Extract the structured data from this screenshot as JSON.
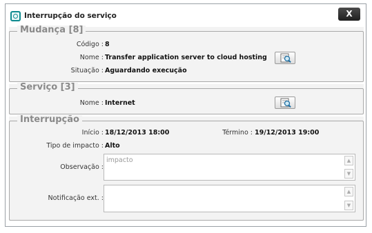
{
  "dialog": {
    "title": "Interrupção do serviço",
    "close_label": "X"
  },
  "mudanca": {
    "legend": "Mudança [8]",
    "codigo_label": "Código :",
    "codigo_value": "8",
    "nome_label": "Nome :",
    "nome_value": "Transfer application server to cloud hosting",
    "situacao_label": "Situação :",
    "situacao_value": "Aguardando execução"
  },
  "servico": {
    "legend": "Serviço [3]",
    "nome_label": "Nome :",
    "nome_value": "Internet"
  },
  "interrupcao": {
    "legend": "Interrupção",
    "inicio_label": "Início :",
    "inicio_value": "18/12/2013 18:00",
    "termino_label": "Término :",
    "termino_value": "19/12/2013 19:00",
    "tipo_label": "Tipo de impacto :",
    "tipo_value": "Alto",
    "observacao_label": "Observação :",
    "observacao_placeholder": "impacto",
    "notificacao_label": "Notificação ext. :",
    "notificacao_value": ""
  },
  "icons": {
    "app": "app-icon",
    "lookup": "magnifier-icon",
    "scroll_up": "scroll-up-icon",
    "scroll_down": "scroll-down-icon"
  },
  "colors": {
    "accent": "#0c8a8f",
    "panel_bg": "#f3f3f3",
    "legend": "#8a8a8a"
  }
}
